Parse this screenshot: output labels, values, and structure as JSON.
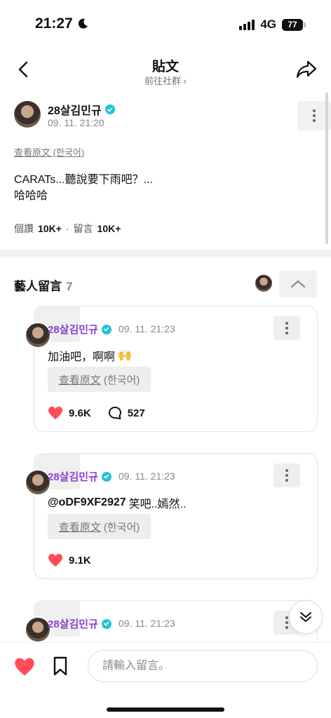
{
  "status_bar": {
    "time": "21:27",
    "network": "4G",
    "battery": "77"
  },
  "header": {
    "title": "貼文",
    "subtitle": "前往社群 ›"
  },
  "post": {
    "author": "28살김민규",
    "timestamp": "09. 11. 21:20",
    "view_original": "查看原文 (한국어)",
    "body": "CARATs...聽說要下雨吧？...\n哈哈哈",
    "likes_label": "個讚",
    "likes_count": "10K+",
    "separator": "·",
    "comments_label": "留言",
    "comments_count": "10K+"
  },
  "artist_comments": {
    "title": "藝人留言",
    "count": "7",
    "items": [
      {
        "author": "28살김민규",
        "timestamp": "09. 11. 21:23",
        "mention": "",
        "text": "加油吧，啊啊",
        "emoji": "🙌",
        "view_original_link": "查看原文",
        "view_original_lang": "(한국어)",
        "likes": "9.6K",
        "replies": "527"
      },
      {
        "author": "28살김민규",
        "timestamp": "09. 11. 21:23",
        "mention": "@oDF9XF2927",
        "text": "笑吧..嫣然..",
        "view_original_link": "查看原文",
        "view_original_lang": "(한국어)",
        "likes": "9.1K"
      },
      {
        "author": "28살김민규",
        "timestamp": "09. 11. 21:23"
      }
    ]
  },
  "bottom_bar": {
    "input_placeholder": "請輸入留言。"
  },
  "colors": {
    "accent_purple": "#8a3fd1",
    "verified": "#22c3d6",
    "like_red": "#ff4d5a"
  },
  "icons": [
    "moon-icon",
    "signal-icon",
    "battery-icon",
    "back-arrow-icon",
    "share-icon",
    "verified-icon",
    "more-vertical-icon",
    "chevron-up-icon",
    "heart-icon",
    "comment-bubble-icon",
    "chevron-down-icon",
    "bookmark-icon"
  ]
}
